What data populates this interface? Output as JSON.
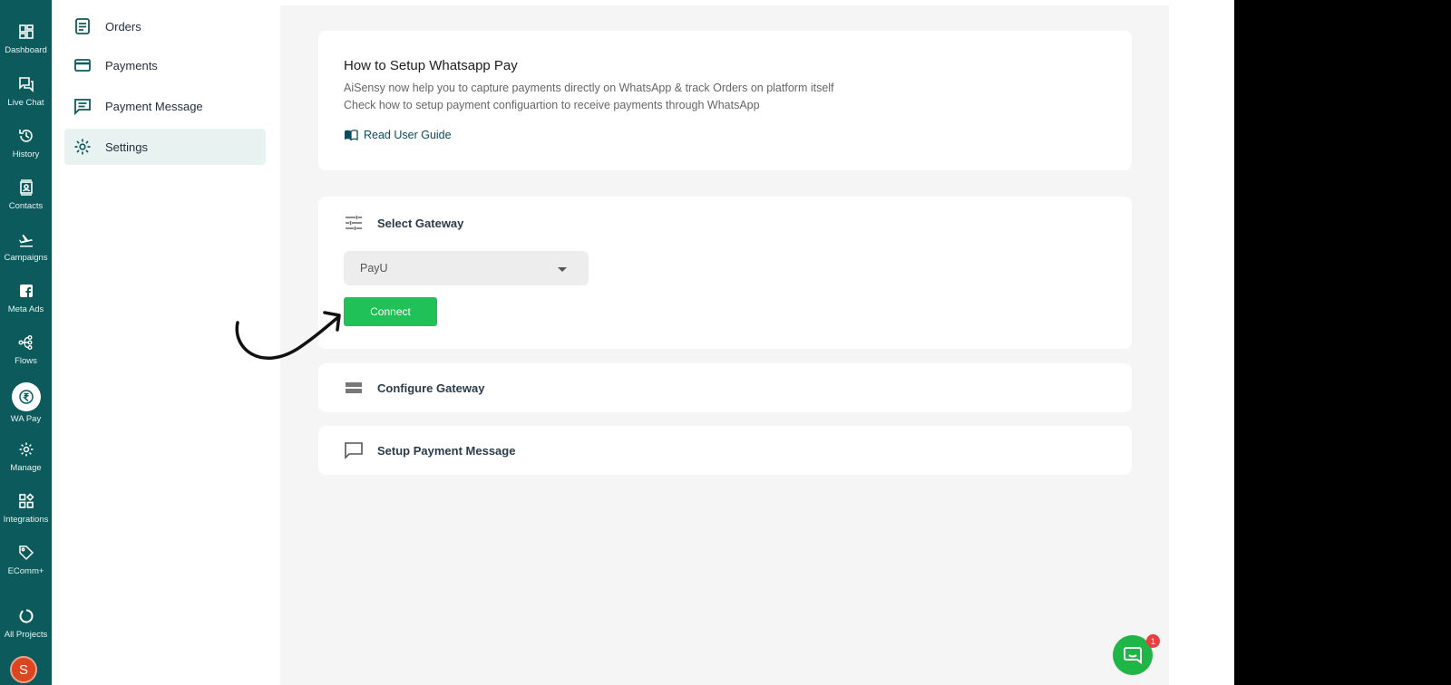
{
  "rail": {
    "items": [
      {
        "label": "Dashboard",
        "icon": "dashboard-icon"
      },
      {
        "label": "Live Chat",
        "icon": "chat-icon"
      },
      {
        "label": "History",
        "icon": "history-icon"
      },
      {
        "label": "Contacts",
        "icon": "contacts-icon"
      },
      {
        "label": "Campaigns",
        "icon": "campaigns-icon"
      },
      {
        "label": "Meta Ads",
        "icon": "facebook-icon"
      },
      {
        "label": "Flows",
        "icon": "flows-icon"
      },
      {
        "label": "WA Pay",
        "icon": "rupee-icon"
      },
      {
        "label": "Manage",
        "icon": "gear-icon"
      },
      {
        "label": "Integrations",
        "icon": "integrations-icon"
      },
      {
        "label": "EComm+",
        "icon": "tag-icon"
      },
      {
        "label": "All Projects",
        "icon": "projects-icon"
      }
    ],
    "avatar_initial": "S",
    "active": "WA Pay"
  },
  "submenu": {
    "items": [
      {
        "label": "Orders",
        "icon": "orders-icon"
      },
      {
        "label": "Payments",
        "icon": "card-icon"
      },
      {
        "label": "Payment Message",
        "icon": "message-icon"
      },
      {
        "label": "Settings",
        "icon": "gear-icon"
      }
    ],
    "active": "Settings"
  },
  "setup_card": {
    "title": "How to Setup Whatsapp Pay",
    "line1": "AiSensy now help you to capture payments directly on WhatsApp & track Orders on platform itself",
    "line2": "Check how to setup payment configuartion to receive payments through WhatsApp",
    "guide_link": "Read User Guide"
  },
  "gateway": {
    "heading": "Select Gateway",
    "selected": "PayU",
    "connect_label": "Connect"
  },
  "configure": {
    "heading": "Configure Gateway"
  },
  "payment_message": {
    "heading": "Setup Payment Message"
  },
  "chat_widget": {
    "badge_count": "1"
  },
  "colors": {
    "rail": "#0c5a5c",
    "accent": "#20c156",
    "active_bg": "#e8f3f1"
  }
}
